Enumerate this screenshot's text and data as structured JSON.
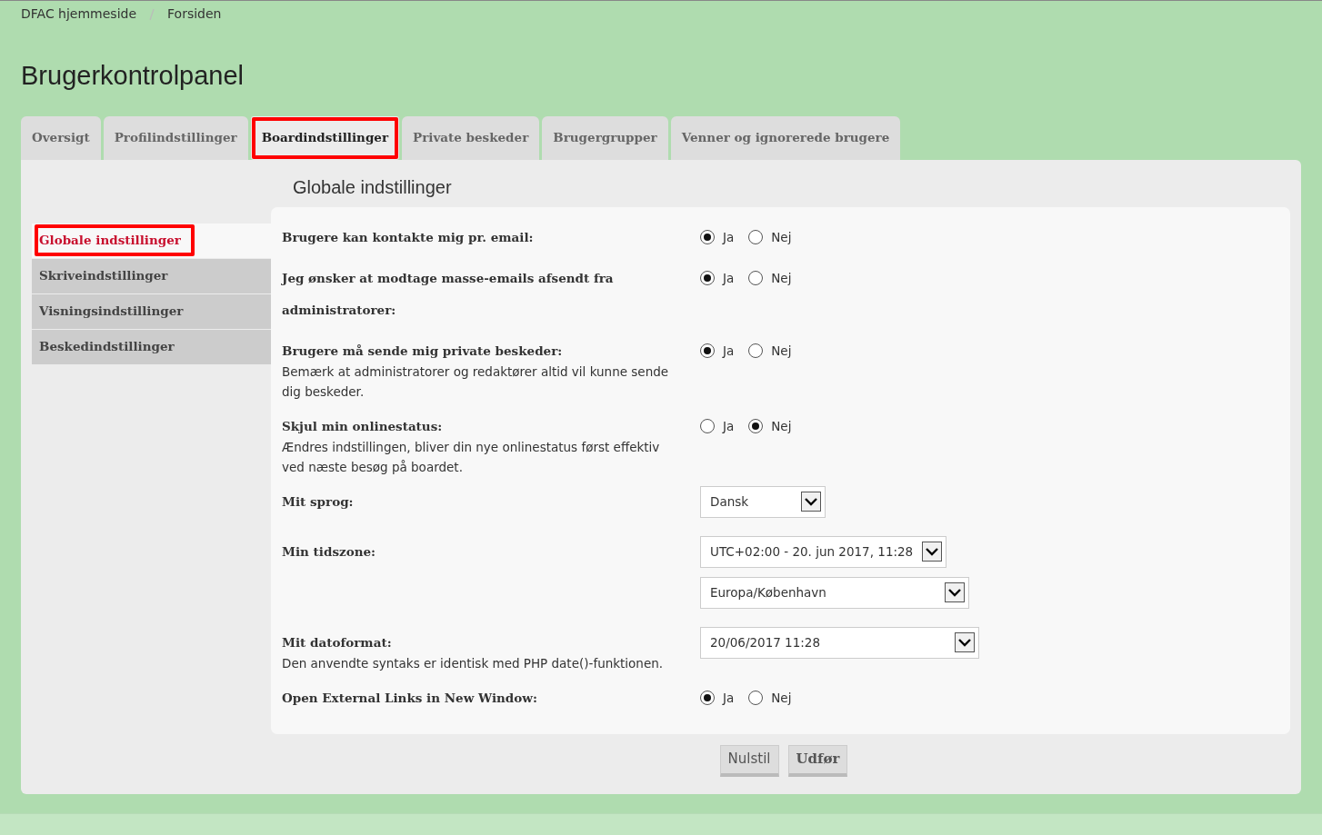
{
  "breadcrumbs": [
    "DFAC hjemmeside",
    "Forsiden"
  ],
  "page_title": "Brugerkontrolpanel",
  "tabs": [
    {
      "label": "Oversigt",
      "selected": false,
      "highlighted": false
    },
    {
      "label": "Profilindstillinger",
      "selected": false,
      "highlighted": false
    },
    {
      "label": "Boardindstillinger",
      "selected": true,
      "highlighted": true
    },
    {
      "label": "Private beskeder",
      "selected": false,
      "highlighted": false
    },
    {
      "label": "Brugergrupper",
      "selected": false,
      "highlighted": false
    },
    {
      "label": "Venner og ignorerede brugere",
      "selected": false,
      "highlighted": false
    }
  ],
  "sidebar": {
    "items": [
      {
        "label": "Globale indstillinger",
        "selected": true,
        "highlighted": true
      },
      {
        "label": "Skriveindstillinger",
        "selected": false,
        "highlighted": false
      },
      {
        "label": "Visningsindstillinger",
        "selected": false,
        "highlighted": false
      },
      {
        "label": "Beskedindstillinger",
        "selected": false,
        "highlighted": false
      }
    ]
  },
  "section_title": "Globale indstillinger",
  "settings": [
    {
      "kind": "radio",
      "label": "Brugere kan kontakte mig pr. email:",
      "options": [
        {
          "label": "Ja",
          "selected": true
        },
        {
          "label": "Nej",
          "selected": false
        }
      ]
    },
    {
      "kind": "radio",
      "label": "Jeg ønsker at modtage masse-emails afsendt fra administratorer:",
      "options": [
        {
          "label": "Ja",
          "selected": true
        },
        {
          "label": "Nej",
          "selected": false
        }
      ]
    },
    {
      "kind": "radio",
      "label": "Brugere må sende mig private beskeder:",
      "note": "Bemærk at administratorer og redaktører altid vil kunne sende dig beskeder.",
      "options": [
        {
          "label": "Ja",
          "selected": true
        },
        {
          "label": "Nej",
          "selected": false
        }
      ]
    },
    {
      "kind": "radio",
      "label": "Skjul min onlinestatus:",
      "note": "Ændres indstillingen, bliver din nye onlinestatus først effektiv ved næste besøg på boardet.",
      "options": [
        {
          "label": "Ja",
          "selected": false
        },
        {
          "label": "Nej",
          "selected": true
        }
      ]
    },
    {
      "kind": "select",
      "label": "Mit sprog:",
      "selects": [
        "Dansk"
      ]
    },
    {
      "kind": "select",
      "label": "Min tidszone:",
      "selects": [
        "UTC+02:00 - 20. jun 2017, 11:28",
        "Europa/København"
      ]
    },
    {
      "kind": "select",
      "label": "Mit datoformat:",
      "note": "Den anvendte syntaks er identisk med PHP date()-funktionen.",
      "selects": [
        "20/06/2017 11:28"
      ]
    },
    {
      "kind": "radio",
      "label": "Open External Links in New Window:",
      "options": [
        {
          "label": "Ja",
          "selected": true
        },
        {
          "label": "Nej",
          "selected": false
        }
      ]
    }
  ],
  "buttons": [
    {
      "label": "Nulstil",
      "kind": "reset"
    },
    {
      "label": "Udfør",
      "kind": "submit"
    }
  ]
}
